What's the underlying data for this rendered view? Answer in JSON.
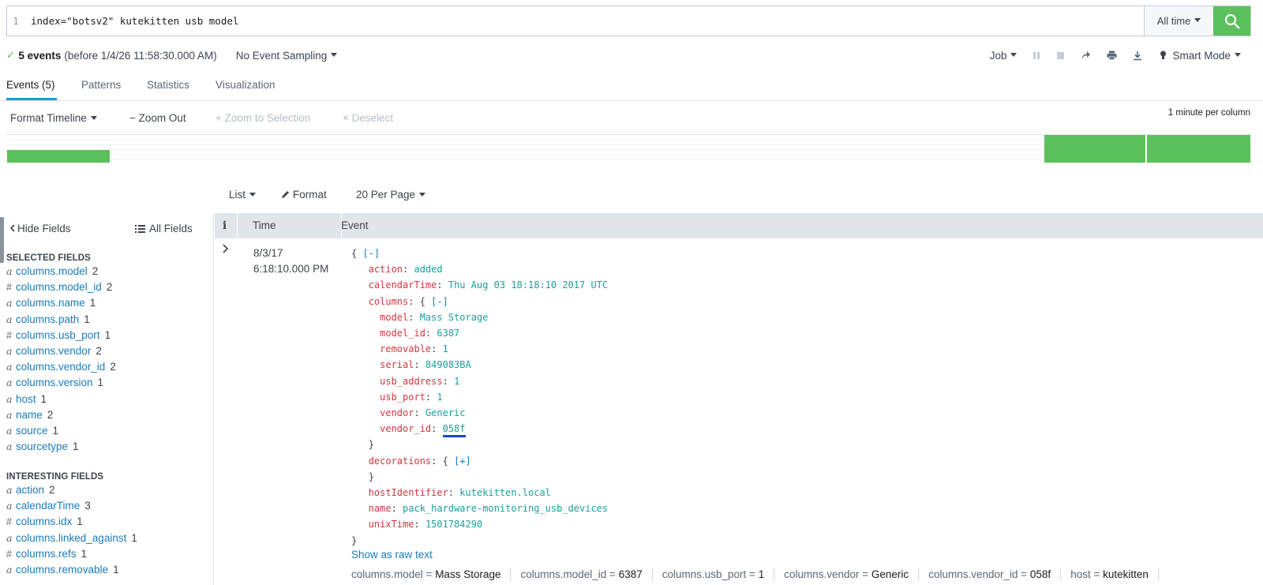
{
  "search": {
    "line_number": "1",
    "query": "index=\"botsv2\" kutekitten usb model",
    "time_range": "All time",
    "submit_icon": "search-icon"
  },
  "status": {
    "check_icon": "✓",
    "event_count": "5 events",
    "before_text": "(before 1/4/26 11:58:30.000 AM)",
    "sampling": "No Event Sampling",
    "job": "Job",
    "mode": "Smart Mode"
  },
  "tabs": [
    "Events (5)",
    "Patterns",
    "Statistics",
    "Visualization"
  ],
  "timeline": {
    "format_label": "Format Timeline",
    "zoom_out": "− Zoom Out",
    "zoom_selection": "+ Zoom to Selection",
    "deselect": "× Deselect",
    "scale_label": "1 minute per column",
    "bar_color": "#5cc05c"
  },
  "results_controls": {
    "list": "List",
    "format": "Format",
    "per_page": "20 Per Page"
  },
  "sidebar": {
    "hide_fields": "Hide Fields",
    "all_fields": "All Fields",
    "selected_title": "SELECTED FIELDS",
    "interesting_title": "INTERESTING FIELDS",
    "selected": [
      {
        "type": "a",
        "name": "columns.model",
        "count": "2"
      },
      {
        "type": "#",
        "name": "columns.model_id",
        "count": "2"
      },
      {
        "type": "a",
        "name": "columns.name",
        "count": "1"
      },
      {
        "type": "a",
        "name": "columns.path",
        "count": "1"
      },
      {
        "type": "#",
        "name": "columns.usb_port",
        "count": "1"
      },
      {
        "type": "a",
        "name": "columns.vendor",
        "count": "2"
      },
      {
        "type": "a",
        "name": "columns.vendor_id",
        "count": "2"
      },
      {
        "type": "a",
        "name": "columns.version",
        "count": "1"
      },
      {
        "type": "a",
        "name": "host",
        "count": "1"
      },
      {
        "type": "a",
        "name": "name",
        "count": "2"
      },
      {
        "type": "a",
        "name": "source",
        "count": "1"
      },
      {
        "type": "a",
        "name": "sourcetype",
        "count": "1"
      }
    ],
    "interesting": [
      {
        "type": "a",
        "name": "action",
        "count": "2"
      },
      {
        "type": "a",
        "name": "calendarTime",
        "count": "3"
      },
      {
        "type": "#",
        "name": "columns.idx",
        "count": "1"
      },
      {
        "type": "a",
        "name": "columns.linked_against",
        "count": "1"
      },
      {
        "type": "#",
        "name": "columns.refs",
        "count": "1"
      },
      {
        "type": "a",
        "name": "columns.removable",
        "count": "1"
      }
    ]
  },
  "table": {
    "col_info": "i",
    "col_time": "Time",
    "col_event": "Event"
  },
  "event": {
    "date": "8/3/17",
    "time": "6:18:10.000 PM",
    "collapse": "[-]",
    "expand": "[+]",
    "action": "added",
    "calendarTime": "Thu Aug 03 18:18:10 2017 UTC",
    "columns": {
      "model": "Mass Storage",
      "model_id": "6387",
      "removable": "1",
      "serial": "849083BA",
      "usb_address": "1",
      "usb_port": "1",
      "vendor": "Generic",
      "vendor_id": "058f"
    },
    "hostIdentifier": "kutekitten.local",
    "name": "pack_hardware-monitoring_usb_devices",
    "unixTime": "1501784290",
    "raw_link": "Show as raw text",
    "summary": [
      {
        "k": "columns.model",
        "v": "Mass Storage"
      },
      {
        "k": "columns.model_id",
        "v": "6387"
      },
      {
        "k": "columns.usb_port",
        "v": "1"
      },
      {
        "k": "columns.vendor",
        "v": "Generic"
      },
      {
        "k": "columns.vendor_id",
        "v": "058f"
      },
      {
        "k": "host",
        "v": "kutekitten"
      }
    ]
  }
}
